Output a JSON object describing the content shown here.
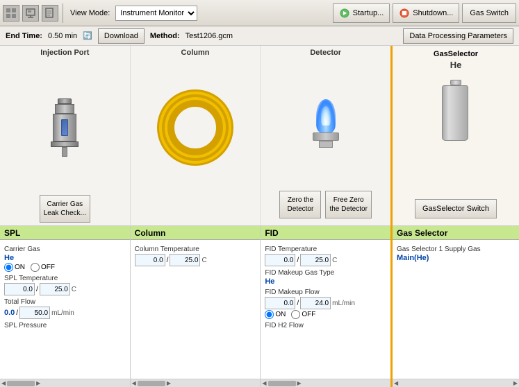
{
  "toolbar": {
    "view_mode_label": "View Mode:",
    "view_mode_value": "Instrument Monitor",
    "startup_btn": "Startup...",
    "shutdown_btn": "Shutdown...",
    "gas_switch_btn": "Gas Switch"
  },
  "info_bar": {
    "end_time_label": "End Time:",
    "end_time_value": "0.50 min",
    "download_btn": "Download",
    "method_label": "Method:",
    "method_value": "Test1206.gcm",
    "data_proc_btn": "Data Processing Parameters"
  },
  "diagram": {
    "injection_port_title": "Injection Port",
    "column_title": "Column",
    "detector_title": "Detector",
    "gas_selector_title": "GasSelector",
    "gas_symbol": "He",
    "carrier_gas_leak_check_btn": "Carrier Gas\nLeak Check...",
    "zero_detector_btn": "Zero the\nDetector",
    "free_zero_detector_btn": "Free Zero\nthe Detector",
    "gas_selector_switch_btn": "GasSelector Switch"
  },
  "spl_panel": {
    "header": "SPL",
    "carrier_gas_label": "Carrier Gas",
    "carrier_gas_value": "He",
    "on_label": "ON",
    "off_label": "OFF",
    "spl_temp_label": "SPL Temperature",
    "spl_temp_current": "0.0",
    "spl_temp_set": "25.0",
    "spl_temp_unit": "C",
    "total_flow_label": "Total Flow",
    "total_flow_current": "0.0",
    "total_flow_set": "50.0",
    "total_flow_unit": "mL/min",
    "spl_pressure_label": "SPL Pressure"
  },
  "column_panel": {
    "header": "Column",
    "column_temp_label": "Column Temperature",
    "column_temp_current": "0.0",
    "column_temp_set": "25.0",
    "column_temp_unit": "C"
  },
  "fid_panel": {
    "header": "FID",
    "fid_temp_label": "FID Temperature",
    "fid_temp_current": "0.0",
    "fid_temp_set": "25.0",
    "fid_temp_unit": "C",
    "makeup_gas_label": "FID Makeup Gas Type",
    "makeup_gas_value": "He",
    "makeup_flow_label": "FID Makeup Flow",
    "makeup_flow_current": "0.0",
    "makeup_flow_set": "24.0",
    "makeup_flow_unit": "mL/min",
    "on_label": "ON",
    "off_label": "OFF",
    "h2_flow_label": "FID H2 Flow"
  },
  "gas_selector_panel": {
    "header": "Gas Selector",
    "supply_gas_label": "Gas Selector 1 Supply Gas",
    "supply_gas_value": "Main(He)"
  }
}
